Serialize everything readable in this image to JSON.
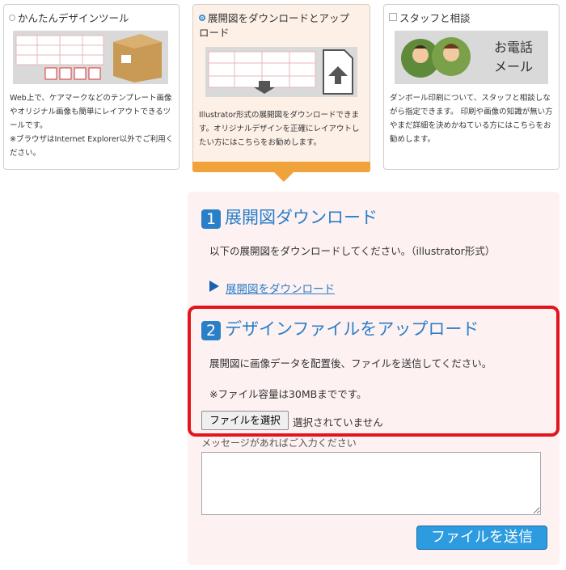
{
  "options": [
    {
      "title": "かんたんデザインツール",
      "selected": false,
      "description": "Web上で、ケアマークなどのテンプレート画像やオリジナル画像も簡単にレイアウトできるツールです。\n※ブラウザはInternet Explorer以外でご利用ください。"
    },
    {
      "title": "展開図をダウンロードとアップロード",
      "selected": true,
      "description": "Illustrator形式の展開図をダウンロードできます。オリジナルデザインを正確にレイアウトしたい方にはこちらをお勧めします。"
    },
    {
      "title": "スタッフと相談",
      "selected": false,
      "illustration_text": "お電話\nメール",
      "description": "ダンボール印刷について、スタッフと相談しながら指定できます。 印刷や画像の知識が無い方やまだ詳細を決めかねている方にはこちらをお勧めします。"
    }
  ],
  "step1": {
    "number": "1",
    "heading": "展開図ダウンロード",
    "text": "以下の展開図をダウンロードしてください。（illustrator形式）",
    "link_label": "展開図をダウンロード"
  },
  "step2": {
    "number": "2",
    "heading": "デザインファイルをアップロード",
    "text": "展開図に画像データを配置後、ファイルを送信してください。",
    "note": "※ファイル容量は30MBまでです。",
    "file_button_label": "ファイルを選択",
    "file_status": "選択されていません"
  },
  "message": {
    "label": "メッセージがあればご入力ください",
    "value": ""
  },
  "submit_label": "ファイルを送信",
  "colors": {
    "accent_blue": "#2a7fc9",
    "highlight_red": "#e2141c",
    "selected_bg": "#fdf0e7",
    "selected_bar": "#f0a33a",
    "panel_bg": "#fdf1f1",
    "send_button": "#2c9be0"
  }
}
